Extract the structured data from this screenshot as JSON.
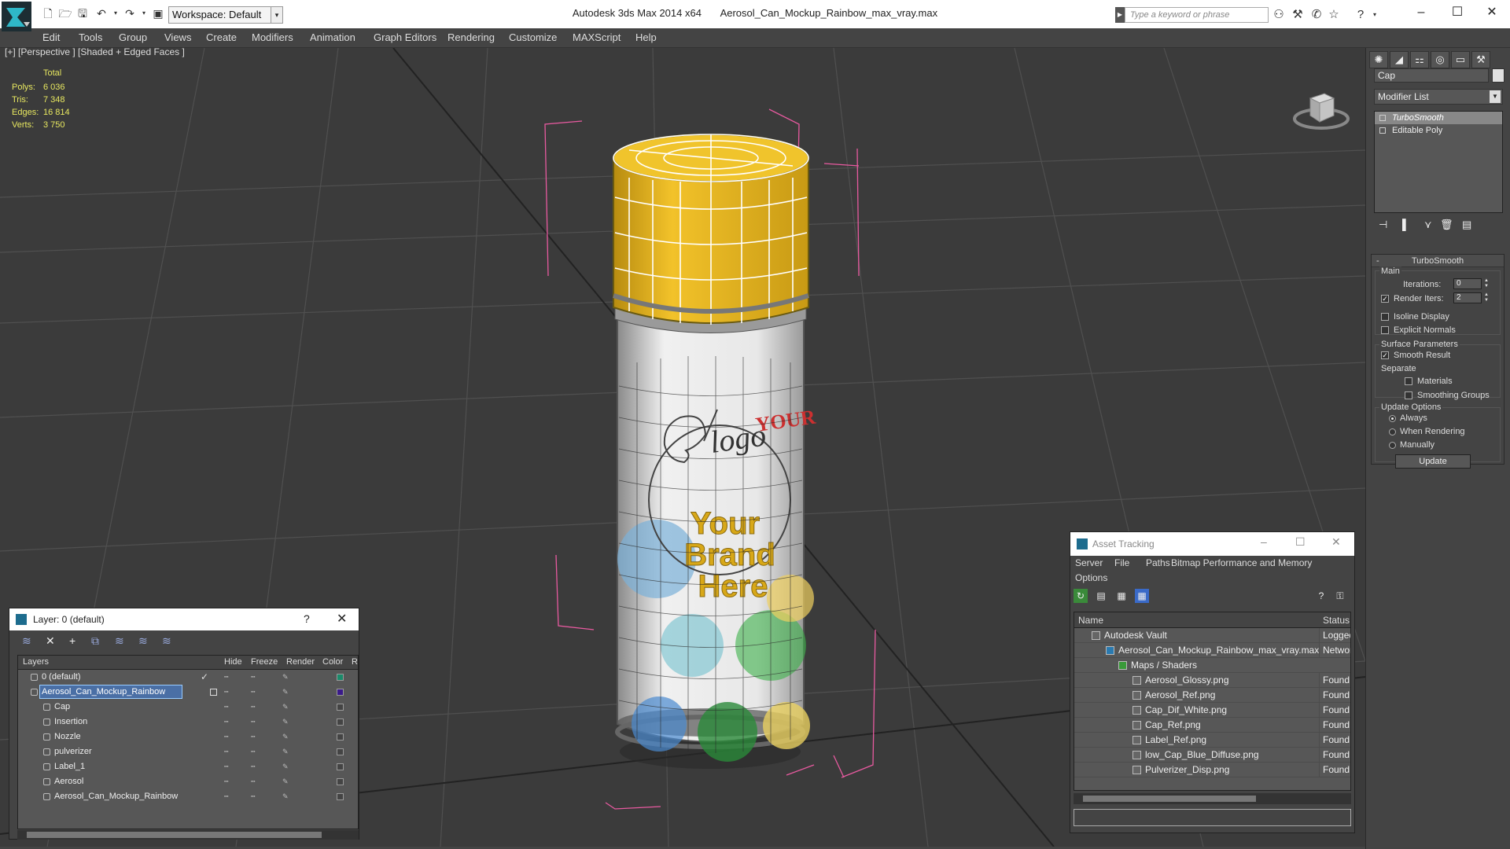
{
  "window": {
    "app_title": "Autodesk 3ds Max  2014 x64",
    "file_title": "Aerosol_Can_Mockup_Rainbow_max_vray.max",
    "workspace": "Workspace: Default",
    "search_placeholder": "Type a keyword or phrase"
  },
  "menu": [
    "Edit",
    "Tools",
    "Group",
    "Views",
    "Create",
    "Modifiers",
    "Animation",
    "Graph Editors",
    "Rendering",
    "Customize",
    "MAXScript",
    "Help"
  ],
  "viewport": {
    "label": "[+] [Perspective ] [Shaded + Edged Faces ]",
    "stats": {
      "total": "Total",
      "rows": [
        {
          "key": "Polys:",
          "val": "6 036"
        },
        {
          "key": "Tris:",
          "val": "7 348"
        },
        {
          "key": "Edges:",
          "val": "16 814"
        },
        {
          "key": "Verts:",
          "val": "3 750"
        }
      ]
    },
    "label_text": {
      "your": "YOUR",
      "logo": "logo",
      "brand1": "Your",
      "brand2": "Brand",
      "brand3": "Here"
    },
    "colors": {
      "cap": "#e8b81e",
      "grid": "#4a4a4a",
      "selection": "#e85aa0"
    }
  },
  "command_panel": {
    "object_name": "Cap",
    "modifier_list": "Modifier List",
    "stack": [
      "TurboSmooth",
      "Editable Poly"
    ],
    "rollout": {
      "title": "TurboSmooth",
      "main_label": "Main",
      "iterations_label": "Iterations:",
      "iterations": "0",
      "render_iters_label": "Render Iters:",
      "render_iters": "2",
      "isoline": "Isoline Display",
      "explicit": "Explicit Normals",
      "surface_label": "Surface Parameters",
      "smooth_result": "Smooth Result",
      "separate_label": "Separate",
      "materials": "Materials",
      "smoothing_groups": "Smoothing Groups",
      "update_label": "Update Options",
      "always": "Always",
      "when_rendering": "When Rendering",
      "manually": "Manually",
      "update_button": "Update"
    }
  },
  "layer_window": {
    "title": "Layer: 0 (default)",
    "columns": {
      "layers": "Layers",
      "hide": "Hide",
      "freeze": "Freeze",
      "render": "Render",
      "color": "Color",
      "r": "R"
    },
    "rows": [
      {
        "name": "0 (default)",
        "color": "#1a8a6a"
      },
      {
        "name": "Aerosol_Can_Mockup_Rainbow",
        "color": "#3a1a8a"
      },
      {
        "name": "Cap",
        "color": "#444444"
      },
      {
        "name": "Insertion",
        "color": "#444444"
      },
      {
        "name": "Nozzle",
        "color": "#444444"
      },
      {
        "name": "pulverizer",
        "color": "#444444"
      },
      {
        "name": "Label_1",
        "color": "#444444"
      },
      {
        "name": "Aerosol",
        "color": "#444444"
      },
      {
        "name": "Aerosol_Can_Mockup_Rainbow",
        "color": "#444444"
      }
    ]
  },
  "asset_window": {
    "title": "Asset Tracking",
    "menu": [
      "Server",
      "File",
      "Paths",
      "Bitmap Performance and Memory",
      "Options"
    ],
    "columns": {
      "name": "Name",
      "status": "Status"
    },
    "rows": [
      {
        "name": "Autodesk Vault",
        "status": "Logged"
      },
      {
        "name": "Aerosol_Can_Mockup_Rainbow_max_vray.max",
        "status": "Network"
      },
      {
        "name": "Maps / Shaders",
        "status": ""
      },
      {
        "name": "Aerosol_Glossy.png",
        "status": "Found"
      },
      {
        "name": "Aerosol_Ref.png",
        "status": "Found"
      },
      {
        "name": "Cap_Dif_White.png",
        "status": "Found"
      },
      {
        "name": "Cap_Ref.png",
        "status": "Found"
      },
      {
        "name": "Label_Ref.png",
        "status": "Found"
      },
      {
        "name": "low_Cap_Blue_Diffuse.png",
        "status": "Found"
      },
      {
        "name": "Pulverizer_Disp.png",
        "status": "Found"
      }
    ]
  }
}
